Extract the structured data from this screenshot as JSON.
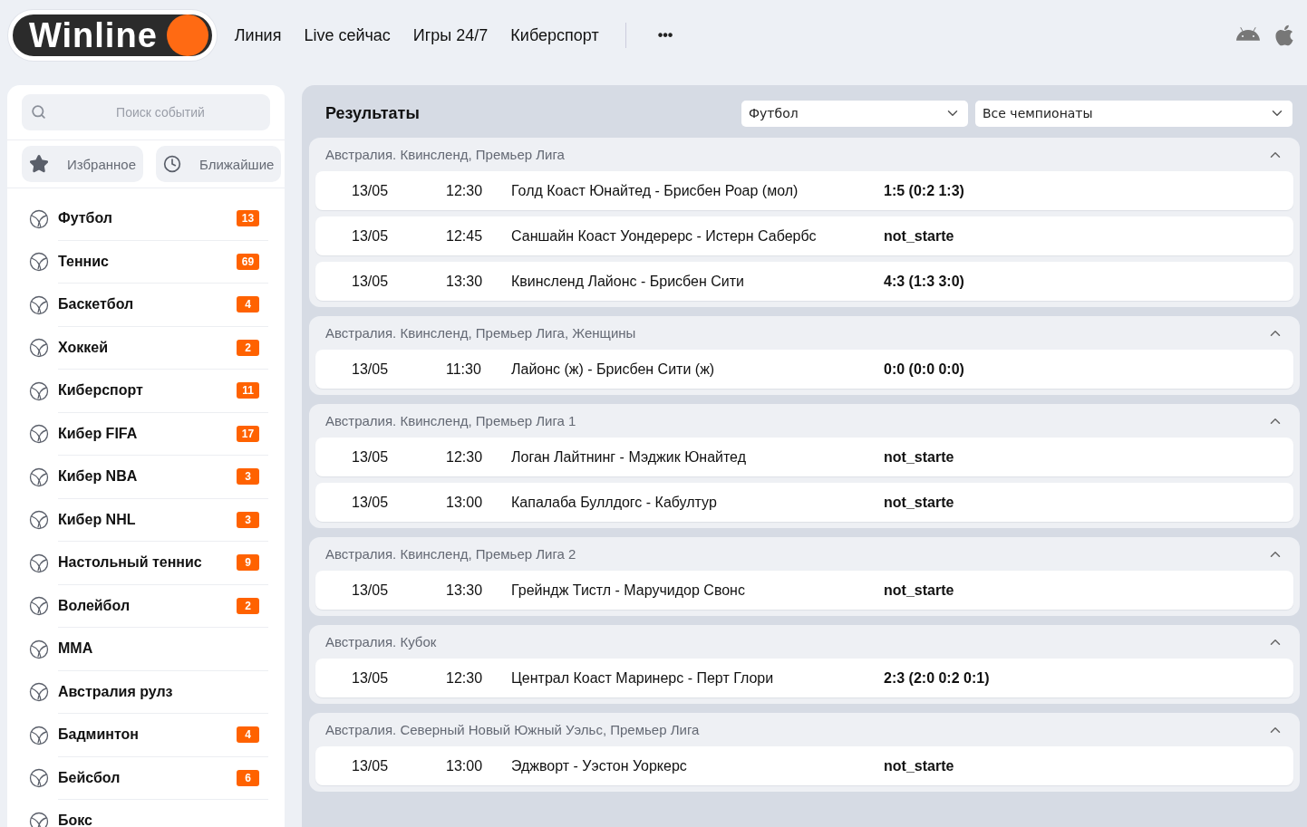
{
  "header": {
    "logo": "Winline",
    "nav": [
      "Линия",
      "Live сейчас",
      "Игры 24/7",
      "Киберспорт"
    ],
    "more": "•••"
  },
  "sidebar": {
    "search": {
      "placeholder": "Поиск событий"
    },
    "quick": [
      "Избранное",
      "Ближайшие"
    ],
    "sports": [
      {
        "name": "Футбол",
        "count": "13"
      },
      {
        "name": "Теннис",
        "count": "69"
      },
      {
        "name": "Баскетбол",
        "count": "4"
      },
      {
        "name": "Хоккей",
        "count": "2"
      },
      {
        "name": "Киберспорт",
        "count": "11"
      },
      {
        "name": "Кибер FIFA",
        "count": "17"
      },
      {
        "name": "Кибер NBA",
        "count": "3"
      },
      {
        "name": "Кибер NHL",
        "count": "3"
      },
      {
        "name": "Настольный теннис",
        "count": "9"
      },
      {
        "name": "Волейбол",
        "count": "2"
      },
      {
        "name": "MMA"
      },
      {
        "name": "Австралия рулз"
      },
      {
        "name": "Бадминтон",
        "count": "4"
      },
      {
        "name": "Бейсбол",
        "count": "6"
      },
      {
        "name": "Бокс"
      }
    ]
  },
  "results": {
    "title": "Результаты",
    "sport_select": "Футбол",
    "league_select": "Все чемпионаты",
    "groups": [
      {
        "name": "Австралия. Квинсленд, Премьер Лига",
        "expanded": true,
        "matches": [
          {
            "date": "13/05",
            "time": "12:30",
            "teams": "Голд Коаст Юнайтед - Брисбен Роар (мол)",
            "score": "1:5 (0:2 1:3)"
          },
          {
            "date": "13/05",
            "time": "12:45",
            "teams": "Саншайн Коаст Уондерерс - Истерн Сабербс",
            "score": "not_starte"
          },
          {
            "date": "13/05",
            "time": "13:30",
            "teams": "Квинсленд Лайонс - Брисбен Сити",
            "score": "4:3 (1:3 3:0)"
          }
        ]
      },
      {
        "name": "Австралия. Квинсленд, Премьер Лига, Женщины",
        "expanded": true,
        "matches": [
          {
            "date": "13/05",
            "time": "11:30",
            "teams": "Лайонс (ж) - Брисбен Сити (ж)",
            "score": "0:0 (0:0 0:0)"
          }
        ]
      },
      {
        "name": "Австралия. Квинсленд, Премьер Лига 1",
        "expanded": true,
        "matches": [
          {
            "date": "13/05",
            "time": "12:30",
            "teams": "Логан Лайтнинг - Мэджик Юнайтед",
            "score": "not_starte"
          },
          {
            "date": "13/05",
            "time": "13:00",
            "teams": "Капалаба Буллдогс - Кабултур",
            "score": "not_starte"
          }
        ]
      },
      {
        "name": "Австралия. Квинсленд, Премьер Лига 2",
        "expanded": true,
        "matches": [
          {
            "date": "13/05",
            "time": "13:30",
            "teams": "Грейндж Тистл - Маручидор Свонс",
            "score": "not_starte"
          }
        ]
      },
      {
        "name": "Австралия. Кубок",
        "expanded": true,
        "matches": [
          {
            "date": "13/05",
            "time": "12:30",
            "teams": "Централ Коаст Маринерс - Перт Глори",
            "score": "2:3 (2:0 0:2 0:1)"
          }
        ]
      },
      {
        "name": "Австралия. Северный Новый Южный Уэльс, Премьер Лига",
        "expanded": true,
        "matches": [
          {
            "date": "13/05",
            "time": "13:00",
            "teams": "Эджворт - Уэстон Уоркерс",
            "score": "not_starte"
          }
        ]
      }
    ]
  }
}
